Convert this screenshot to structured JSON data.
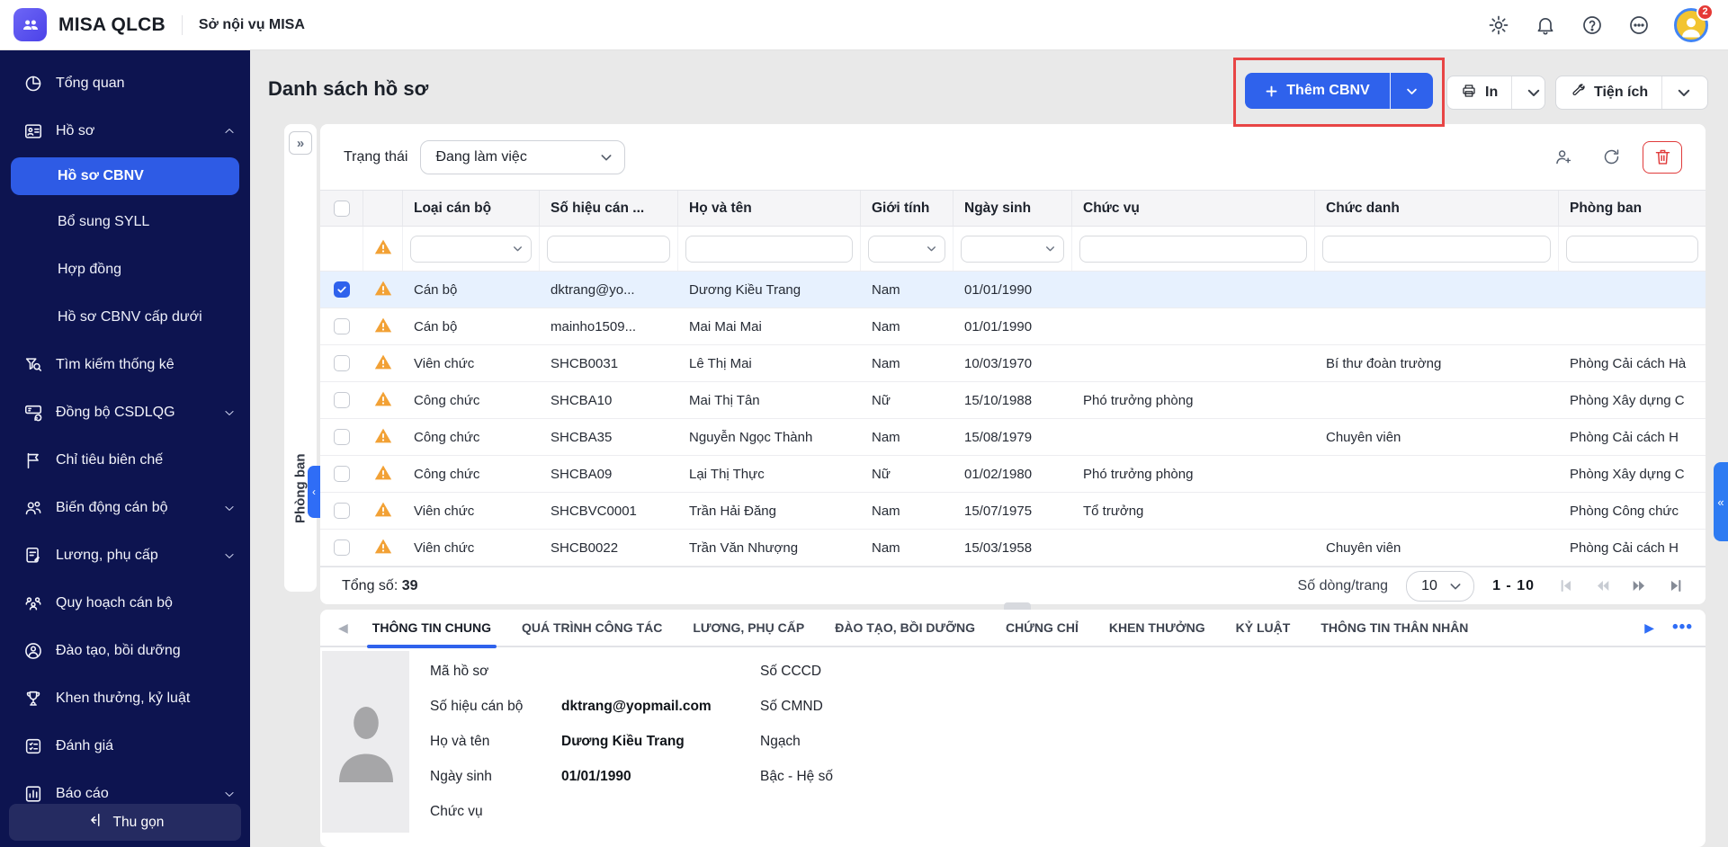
{
  "colors": {
    "accent_blue": "#2f62ec",
    "sidebar_bg": "#0d1450",
    "annotation_red": "#e84545",
    "warning_orange": "#f2a135",
    "danger_red": "#e03b3b",
    "selected_row": "#e7f1fe"
  },
  "header": {
    "app_name": "MISA QLCB",
    "org_name": "Sở nội vụ MISA",
    "avatar_badge": "2"
  },
  "sidebar": {
    "items": [
      {
        "label": "Tổng quan",
        "icon": "overview"
      },
      {
        "label": "Hồ sơ",
        "icon": "profile",
        "chevron": "up",
        "children": [
          {
            "label": "Hồ sơ CBNV",
            "active": true
          },
          {
            "label": "Bổ sung SYLL",
            "active": false
          },
          {
            "label": "Hợp đồng",
            "active": false
          },
          {
            "label": "Hồ sơ CBNV cấp dưới",
            "active": false
          }
        ]
      },
      {
        "label": "Tìm kiếm thống kê",
        "icon": "search-stats"
      },
      {
        "label": "Đồng bộ CSDLQG",
        "icon": "sync",
        "chevron": "down"
      },
      {
        "label": "Chỉ tiêu biên chế",
        "icon": "flag"
      },
      {
        "label": "Biến động cán bộ",
        "icon": "people-change",
        "chevron": "down"
      },
      {
        "label": "Lương, phụ cấp",
        "icon": "salary",
        "chevron": "down"
      },
      {
        "label": "Quy hoạch cán bộ",
        "icon": "planning"
      },
      {
        "label": "Đào tạo, bồi dưỡng",
        "icon": "training"
      },
      {
        "label": "Khen thưởng, kỷ luật",
        "icon": "award"
      },
      {
        "label": "Đánh giá",
        "icon": "evaluation"
      },
      {
        "label": "Báo cáo",
        "icon": "report",
        "chevron": "down"
      }
    ],
    "collapse_label": "Thu gọn"
  },
  "page": {
    "title": "Danh sách hồ sơ",
    "add_button": "Thêm CBNV",
    "print_button": "In",
    "utilities_button": "Tiện ích"
  },
  "toolbar": {
    "status_label": "Trạng thái",
    "status_value": "Đang làm việc"
  },
  "side_strip": {
    "collapsed_panel_label": "Phòng ban",
    "expand_glyph": "»",
    "panel_tab_glyph": "‹"
  },
  "table": {
    "columns": [
      "Loại cán bộ",
      "Số hiệu cán ...",
      "Họ và tên",
      "Giới tính",
      "Ngày sinh",
      "Chức vụ",
      "Chức danh",
      "Phòng ban"
    ],
    "filter_types": [
      "select",
      "input",
      "input",
      "select",
      "select",
      "input",
      "input",
      "input"
    ],
    "rows": [
      {
        "checked": true,
        "warning": true,
        "cells": [
          "Cán bộ",
          "dktrang@yo...",
          "Dương Kiều Trang",
          "Nam",
          "01/01/1990",
          "",
          "",
          ""
        ]
      },
      {
        "checked": false,
        "warning": true,
        "cells": [
          "Cán bộ",
          "mainho1509...",
          "Mai Mai Mai",
          "Nam",
          "01/01/1990",
          "",
          "",
          ""
        ]
      },
      {
        "checked": false,
        "warning": true,
        "cells": [
          "Viên chức",
          "SHCB0031",
          "Lê Thị Mai",
          "Nam",
          "10/03/1970",
          "",
          "Bí thư đoàn trường",
          "Phòng Cải cách Hà"
        ]
      },
      {
        "checked": false,
        "warning": true,
        "cells": [
          "Công chức",
          "SHCBA10",
          "Mai Thị Tân",
          "Nữ",
          "15/10/1988",
          "Phó trưởng phòng",
          "",
          "Phòng Xây dựng C"
        ]
      },
      {
        "checked": false,
        "warning": true,
        "cells": [
          "Công chức",
          "SHCBA35",
          "Nguyễn Ngọc Thành",
          "Nam",
          "15/08/1979",
          "",
          "Chuyên viên",
          "Phòng Cải cách H"
        ]
      },
      {
        "checked": false,
        "warning": true,
        "cells": [
          "Công chức",
          "SHCBA09",
          "Lại Thị Thực",
          "Nữ",
          "01/02/1980",
          "Phó trưởng phòng",
          "",
          "Phòng Xây dựng C"
        ]
      },
      {
        "checked": false,
        "warning": true,
        "cells": [
          "Viên chức",
          "SHCBVC0001",
          "Trần Hải Đăng",
          "Nam",
          "15/07/1975",
          "Tổ trưởng",
          "",
          "Phòng Công chức"
        ]
      },
      {
        "checked": false,
        "warning": true,
        "cells": [
          "Viên chức",
          "SHCB0022",
          "Trần Văn Nhượng",
          "Nam",
          "15/03/1958",
          "",
          "Chuyên viên",
          "Phòng Cải cách H"
        ]
      }
    ],
    "total_label": "Tổng số:",
    "total_value": "39",
    "rows_per_page_label": "Số dòng/trang",
    "rows_per_page": "10",
    "page_range": "1 - 10"
  },
  "detail": {
    "tabs": [
      "THÔNG TIN CHUNG",
      "QUÁ TRÌNH CÔNG TÁC",
      "LƯƠNG, PHỤ CẤP",
      "ĐÀO TẠO, BỒI DƯỠNG",
      "CHỨNG CHỈ",
      "KHEN THƯỞNG",
      "KỶ LUẬT",
      "THÔNG TIN THÂN NHÂN"
    ],
    "active_tab": "THÔNG TIN CHUNG",
    "fields_left": [
      {
        "label": "Mã hồ sơ",
        "value": ""
      },
      {
        "label": "Số hiệu cán bộ",
        "value": "dktrang@yopmail.com"
      },
      {
        "label": "Họ và tên",
        "value": "Dương Kiều Trang"
      },
      {
        "label": "Ngày sinh",
        "value": "01/01/1990"
      },
      {
        "label": "Chức vụ",
        "value": ""
      }
    ],
    "fields_right": [
      {
        "label": "Số CCCD",
        "value": ""
      },
      {
        "label": "Số CMND",
        "value": ""
      },
      {
        "label": "Ngạch",
        "value": ""
      },
      {
        "label": "Bậc - Hệ số",
        "value": ""
      }
    ]
  }
}
